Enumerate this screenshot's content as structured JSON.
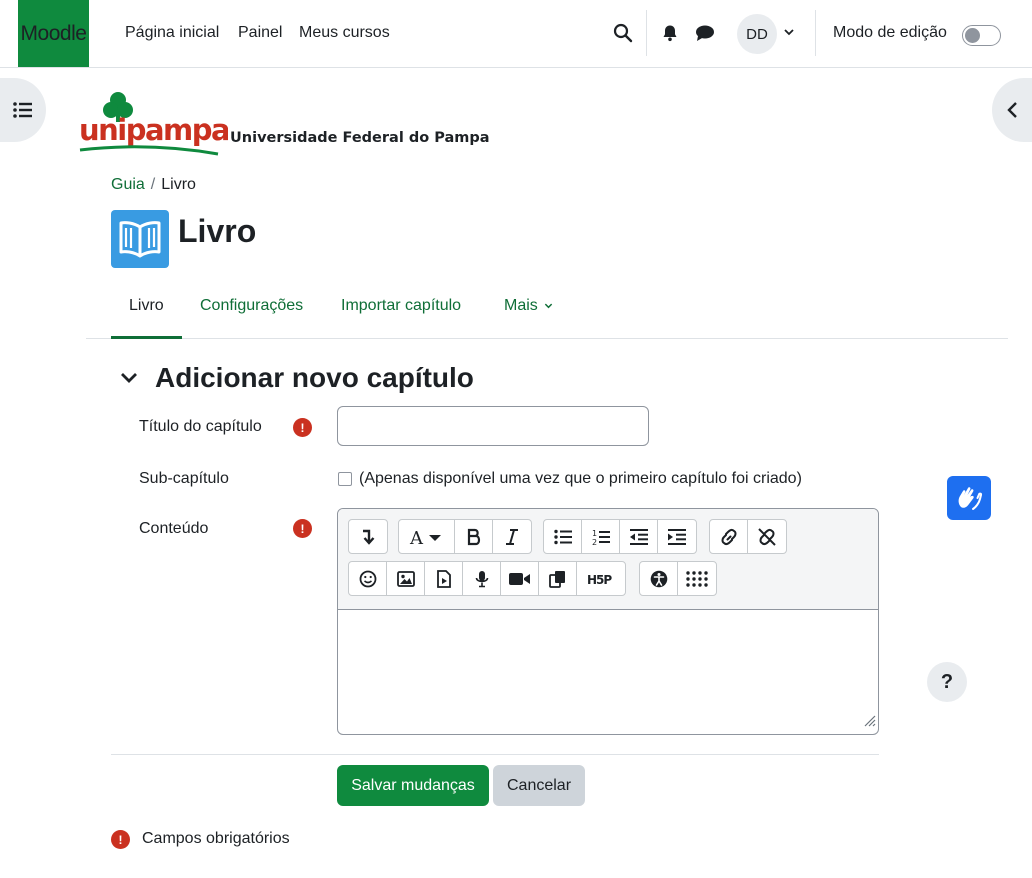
{
  "navbar": {
    "brand": "Moodle",
    "links": [
      "Página inicial",
      "Painel",
      "Meus cursos"
    ],
    "user_initials": "DD",
    "edit_mode_label": "Modo de edição",
    "edit_mode_on": false
  },
  "logo": {
    "wordmark": "unipampa",
    "subtitle": "Universidade Federal do Pampa"
  },
  "breadcrumb": {
    "items": [
      "Guia",
      "Livro"
    ]
  },
  "header": {
    "title": "Livro"
  },
  "tabs": {
    "items": [
      "Livro",
      "Configurações",
      "Importar capítulo",
      "Mais"
    ],
    "active": "Livro"
  },
  "form": {
    "section_title": "Adicionar novo capítulo",
    "title_label": "Título do capítulo",
    "title_value": "",
    "subchapter_label": "Sub-capítulo",
    "subchapter_note": "(Apenas disponível uma vez que o primeiro capítulo foi criado)",
    "content_label": "Conteúdo",
    "required_note": "Campos obrigatórios"
  },
  "buttons": {
    "save": "Salvar mudanças",
    "cancel": "Cancelar"
  },
  "help": {
    "label": "?"
  },
  "colors": {
    "brand": "#0f8a3e",
    "link": "#0f6e37",
    "required": "#ca3120",
    "module_icon": "#399be2",
    "vlibras": "#1e6ff0"
  }
}
